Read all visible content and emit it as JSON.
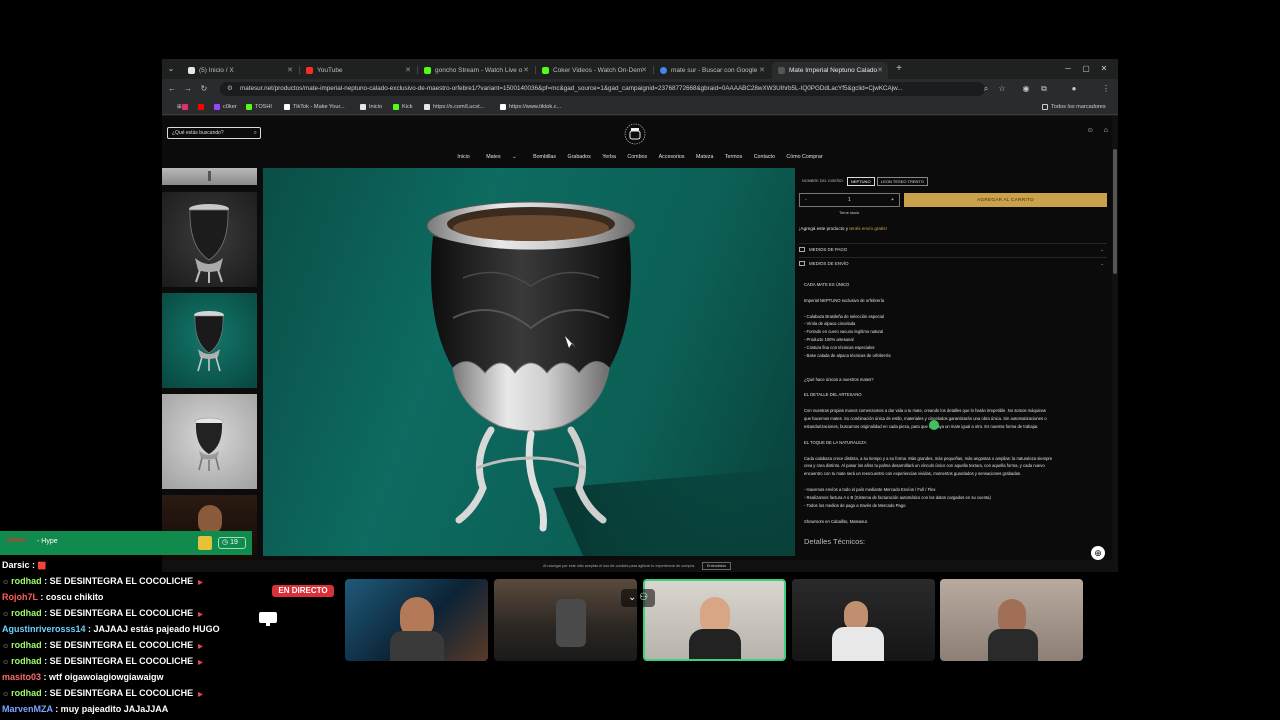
{
  "browser": {
    "tabs": [
      {
        "title": "(5) Inicio / X",
        "color": "#e6e6e6"
      },
      {
        "title": "YouTube",
        "color": "#ff2b2b"
      },
      {
        "title": "goncho Stream - Watch Live o",
        "color": "#53fc18"
      },
      {
        "title": "Coker Videos - Watch On-Dem",
        "color": "#53fc18"
      },
      {
        "title": "mate sur - Buscar con Google",
        "color": "#4285f4"
      },
      {
        "title": "Mate Imperial Neptuno Calado",
        "color": "#cccccc"
      }
    ],
    "new_tab": "+",
    "url": "matesur.net/productos/mate-imperial-neptuno-calado-exclusivo-de-maestro-orfebre1/?variant=1500140036&pf=mc&gad_source=1&gad_campaignid=23768772668&gbraid=0AAAABC28wXW3UIhrb5L-IQ0PGDdLacYf5&gclid=CjwKCAjw...",
    "bookmarks": [
      {
        "label": "",
        "color": "#e1306c"
      },
      {
        "label": "",
        "color": "#ff0000"
      },
      {
        "label": "c0ker",
        "color": "#9146ff"
      },
      {
        "label": "TOSHI",
        "color": "#53fc18"
      },
      {
        "label": "TikTok - Make Your...",
        "color": "#ffffff"
      },
      {
        "label": "Inicio",
        "color": "#e6e6e6"
      },
      {
        "label": "Kick",
        "color": "#53fc18"
      },
      {
        "label": "https://x.com/Lucst...",
        "color": "#e6e6e6"
      },
      {
        "label": "https://www.tiktok.c...",
        "color": "#ffffff"
      }
    ],
    "all_bookmarks": "Todos los marcadores"
  },
  "site": {
    "search_placeholder": "¿Qué estás buscando?",
    "nav": [
      "Inicio",
      "Mates",
      "Bombillas",
      "Grabados",
      "Yerba",
      "Combos",
      "Accesorios",
      "Mateza",
      "Termos",
      "Contacto",
      "Cómo Comprar"
    ],
    "variant_label": "NOMBRE DEL DISEÑO:",
    "variants": [
      "NEPTUNO",
      "LEON TESEO TRENTO"
    ],
    "quantity": "1",
    "qty_minus": "-",
    "qty_plus": "+",
    "add_to_cart": "AGREGAR AL CARRITO",
    "stock": "Tiene stock",
    "free_shipping_pre": "¡Agregá este producto y ",
    "free_shipping_link": "tenés envío gratis!",
    "accordions": [
      "MEDIOS DE PAGO",
      "MEDIOS DE ENVÍO"
    ],
    "description": [
      "CADA MATE ES ÚNICO",
      "",
      "Imperial NEPTUNO exclusivo de orfebrería",
      "",
      "- Calabaza Brasileña de selección especial",
      "- Virola de alpaca cincelada",
      "- Forrado en cuero vacuno legítimo natural",
      "- Producto 100% artesanal",
      "- Costura fina con técnicas especiales",
      "- Base calada de alpaca técnicas de orfebrería",
      "",
      "",
      "¿Qué hace únicos a nuestros mates?",
      "",
      "EL DETALLE DEL ARTESANO",
      "",
      "Con nuestras propias manos comenzamos a dar vida a tu mate, creando los detalles que lo harán irrepetible. No somos máquinas",
      "que hacemos mates. Su combinación única de estilo, materiales y cincelados garantizarán una obra única. Sin automatizaciones o",
      "estandarizaciones, buscamos originalidad en cada pieza, para que no haya un mate igual a otro. Es nuestra forma de trabajar.",
      "",
      "EL TOQUE DE LA NATURALEZA",
      "",
      "Cada calabaza crece distinta, a su tiempo y a su forma. Más grandes, más pequeñas, más angostas o amplias: la naturaleza siempre",
      "crea y crea distinto. Al pasar los años tu palma desarrollará un vínculo único con aquella textura, con aquella forma, y cada nuevo",
      "encuentro con tu mate será un reencuentro con experiencias vividas, momentos guardados y sensaciones grabadas.",
      "",
      "- Hacemos envíos a todo el país mediante Mercado Envíos / Full / Flex",
      "- Realizamos factura A o B (Sistema de facturación automático con los datos cargados en su cuenta)",
      "- Todos los medios de pago a través de Mercado Pago",
      "",
      "Showroom en Caballito, Mateasur."
    ],
    "tech_details": "Detalles Técnicos:",
    "cookie_text": "Al navegar por este sitio aceptás el uso de cookies para agilizar tu experiencia de compra.",
    "cookie_ok": "Entendidos"
  },
  "stream": {
    "hype_user": "JoTtz0",
    "hype_label": "- Hype",
    "hype_count": "19",
    "live_label": "EN DIRECTO",
    "chat": [
      {
        "user": "Darsic",
        "msg": " : ",
        "user_color": "#ffffff",
        "icon": "",
        "badge": "🟥",
        "red": ""
      },
      {
        "user": "rodhad",
        "msg": " : SE DESINTEGRA EL COCOLICHE",
        "user_color": "#9cff6c",
        "icon": "☺",
        "badge": "",
        "red": "▶"
      },
      {
        "user": "Rojoh7L",
        "msg": " : coscu chikito",
        "user_color": "#ff5a5a",
        "icon": "",
        "badge": "",
        "red": ""
      },
      {
        "user": "rodhad",
        "msg": " : SE DESINTEGRA EL COCOLICHE",
        "user_color": "#9cff6c",
        "icon": "☺",
        "badge": "",
        "red": "▶"
      },
      {
        "user": "Agustinriverosss14",
        "msg": " : JAJAAJ estás pajeado HUGO",
        "user_color": "#6fd0ff",
        "icon": "",
        "badge": "",
        "red": ""
      },
      {
        "user": "rodhad",
        "msg": " : SE DESINTEGRA EL COCOLICHE",
        "user_color": "#9cff6c",
        "icon": "☺",
        "badge": "",
        "red": "▶"
      },
      {
        "user": "rodhad",
        "msg": " : SE DESINTEGRA EL COCOLICHE",
        "user_color": "#9cff6c",
        "icon": "☺",
        "badge": "",
        "red": "▶"
      },
      {
        "user": "masito03",
        "msg": " : wtf oigawoiagiowgiawaigw",
        "user_color": "#ff6b6b",
        "icon": "",
        "badge": "",
        "red": ""
      },
      {
        "user": "rodhad",
        "msg": " : SE DESINTEGRA EL COCOLICHE",
        "user_color": "#9cff6c",
        "icon": "☺",
        "badge": "",
        "red": "▶"
      },
      {
        "user": "MarvenMZA",
        "msg": " : muy pajeadito JAJaJJAA",
        "user_color": "#79a6ff",
        "icon": "",
        "badge": "",
        "red": ""
      }
    ]
  }
}
